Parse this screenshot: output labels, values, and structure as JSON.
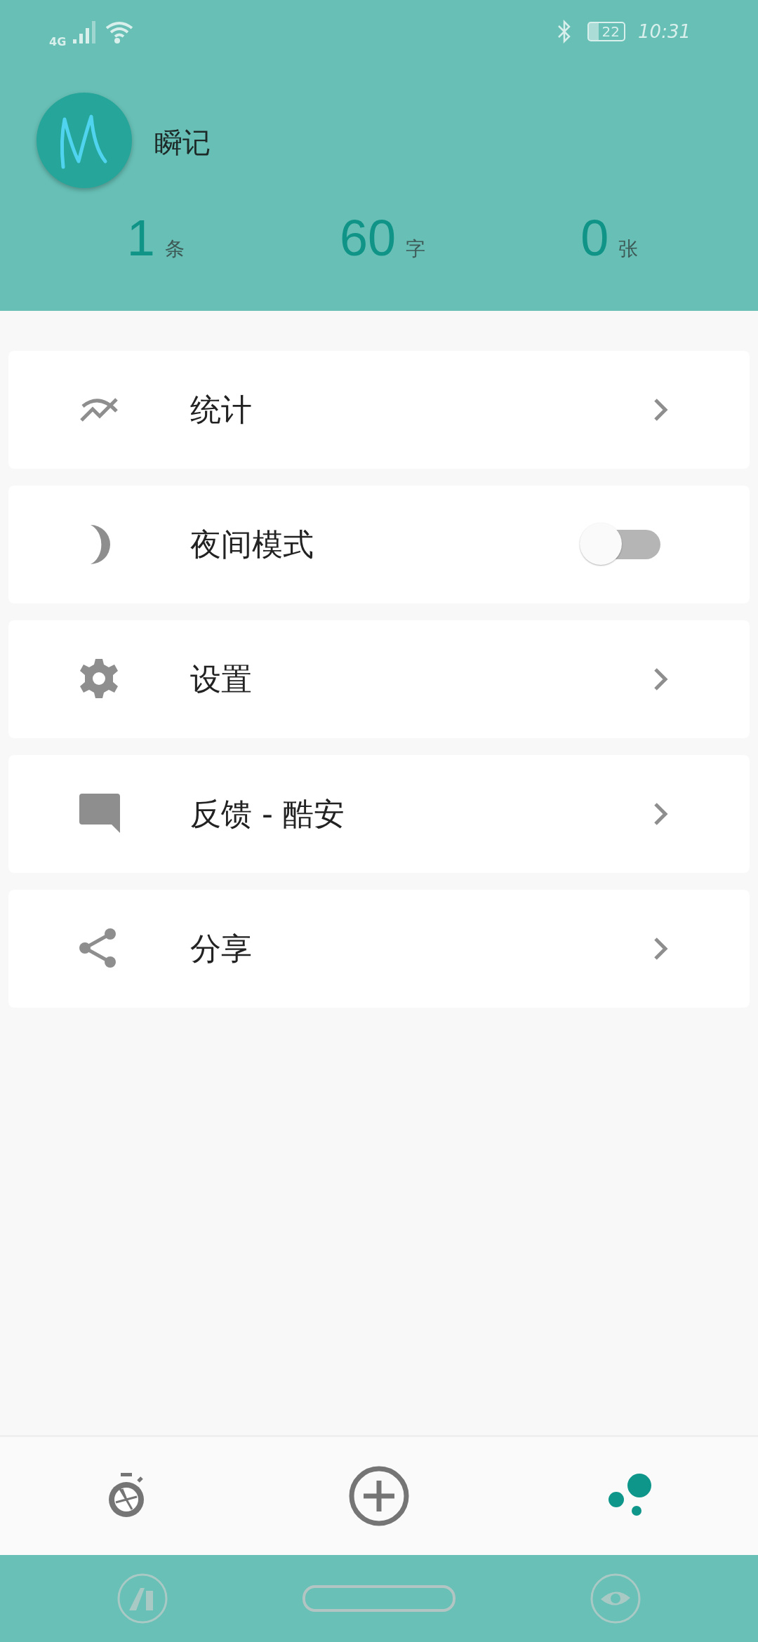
{
  "status_bar": {
    "network": "4G",
    "battery": "22",
    "time": "10:31"
  },
  "profile": {
    "name": "瞬记"
  },
  "stats": [
    {
      "value": "1",
      "unit": "条"
    },
    {
      "value": "60",
      "unit": "字"
    },
    {
      "value": "0",
      "unit": "张"
    }
  ],
  "menu": [
    {
      "kind": "link",
      "label": "统计"
    },
    {
      "kind": "toggle",
      "label": "夜间模式",
      "on": false
    },
    {
      "kind": "link",
      "label": "设置"
    },
    {
      "kind": "link",
      "label": "反馈 - 酷安"
    },
    {
      "kind": "link",
      "label": "分享"
    }
  ],
  "bottom_nav": [
    {
      "selected": false
    },
    {
      "selected": false
    },
    {
      "selected": true
    }
  ]
}
